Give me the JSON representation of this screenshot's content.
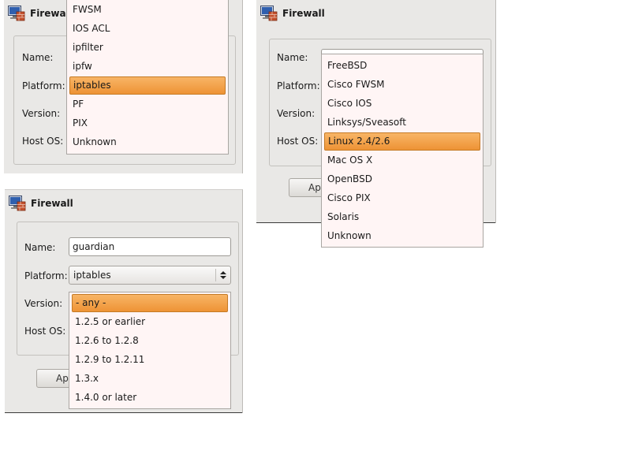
{
  "panels": {
    "top_left": {
      "title": "Firewall",
      "labels": {
        "name": "Name:",
        "platform": "Platform:",
        "version": "Version:",
        "host_os": "Host OS:"
      },
      "platform_menu": {
        "items": [
          "FWSM",
          "IOS ACL",
          "ipfilter",
          "ipfw",
          "iptables",
          "PF",
          "PIX",
          "Unknown"
        ],
        "selected": "iptables"
      }
    },
    "right": {
      "title": "Firewall",
      "labels": {
        "name": "Name:",
        "platform": "Platform:",
        "version": "Version:",
        "host_os": "Host OS:"
      },
      "apply_label_partial": "Ap",
      "host_os_menu": {
        "items": [
          "FreeBSD",
          "Cisco FWSM",
          "Cisco IOS",
          "Linksys/Sveasoft",
          "Linux 2.4/2.6",
          "Mac OS X",
          "OpenBSD",
          "Cisco PIX",
          "Solaris",
          "Unknown"
        ],
        "selected": "Linux 2.4/2.6"
      }
    },
    "bottom_left": {
      "title": "Firewall",
      "labels": {
        "name": "Name:",
        "platform": "Platform:",
        "version": "Version:",
        "host_os": "Host OS:"
      },
      "name_value": "guardian",
      "platform_value": "iptables",
      "apply_label_partial": "Ap",
      "version_menu": {
        "items": [
          "- any -",
          "1.2.5 or earlier",
          "1.2.6 to 1.2.8",
          "1.2.9 to 1.2.11",
          "1.3.x",
          "1.4.0 or later"
        ],
        "selected": "- any -"
      }
    }
  },
  "icons": {
    "window_icon": "firewall-window-icon"
  },
  "colors": {
    "selection": "#f0a045",
    "menu_bg": "#fff5f5",
    "panel_bg": "#e9e8e6"
  }
}
